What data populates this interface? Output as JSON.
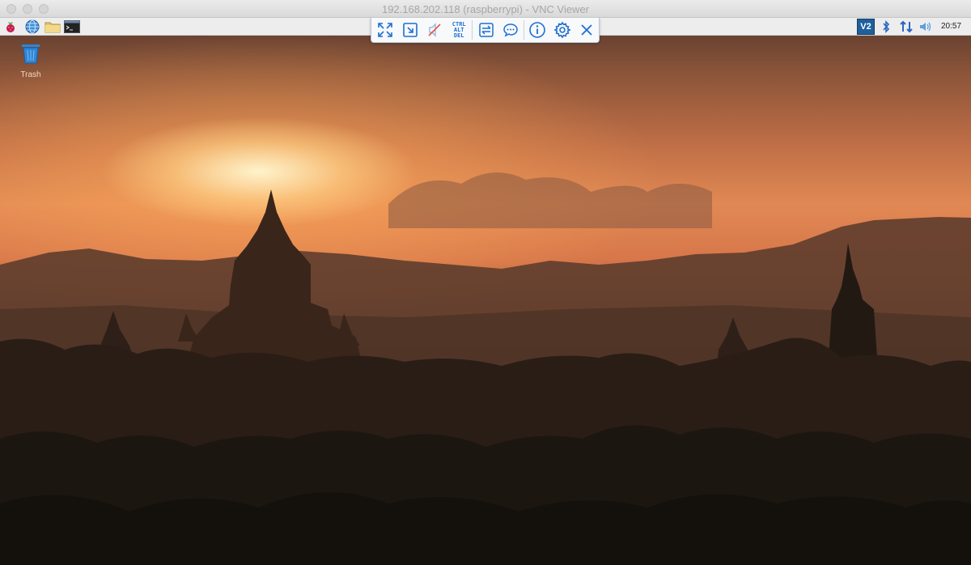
{
  "window": {
    "title": "192.168.202.118 (raspberrypi) - VNC Viewer"
  },
  "vnc_toolbar": {
    "buttons": [
      {
        "name": "fullscreen-button",
        "icon": "expand-icon"
      },
      {
        "name": "scale-button",
        "icon": "scale-icon"
      },
      {
        "name": "mute-button",
        "icon": "mute-icon"
      },
      {
        "name": "ctrl-alt-del-button",
        "icon": "ctrl-alt-del-icon"
      },
      {
        "name": "transfer-files-button",
        "icon": "file-transfer-icon"
      },
      {
        "name": "chat-button",
        "icon": "chat-icon"
      },
      {
        "name": "info-button",
        "icon": "info-icon"
      },
      {
        "name": "settings-button",
        "icon": "gear-icon"
      },
      {
        "name": "close-button",
        "icon": "close-icon"
      }
    ],
    "cad_line1": "CTRL",
    "cad_line2": "ALT",
    "cad_line3": "DEL"
  },
  "panel": {
    "launchers": [
      "raspberry-menu-icon",
      "web-browser-icon",
      "file-manager-icon",
      "terminal-icon"
    ],
    "vnc_badge": "V2",
    "tray": [
      "bluetooth-icon",
      "network-icon",
      "volume-icon"
    ],
    "clock": "20:57"
  },
  "desktop": {
    "trash_label": "Trash"
  },
  "colors": {
    "toolbar_icon": "#1f6fd1",
    "vnc_badge_bg": "#1f5f9c"
  }
}
